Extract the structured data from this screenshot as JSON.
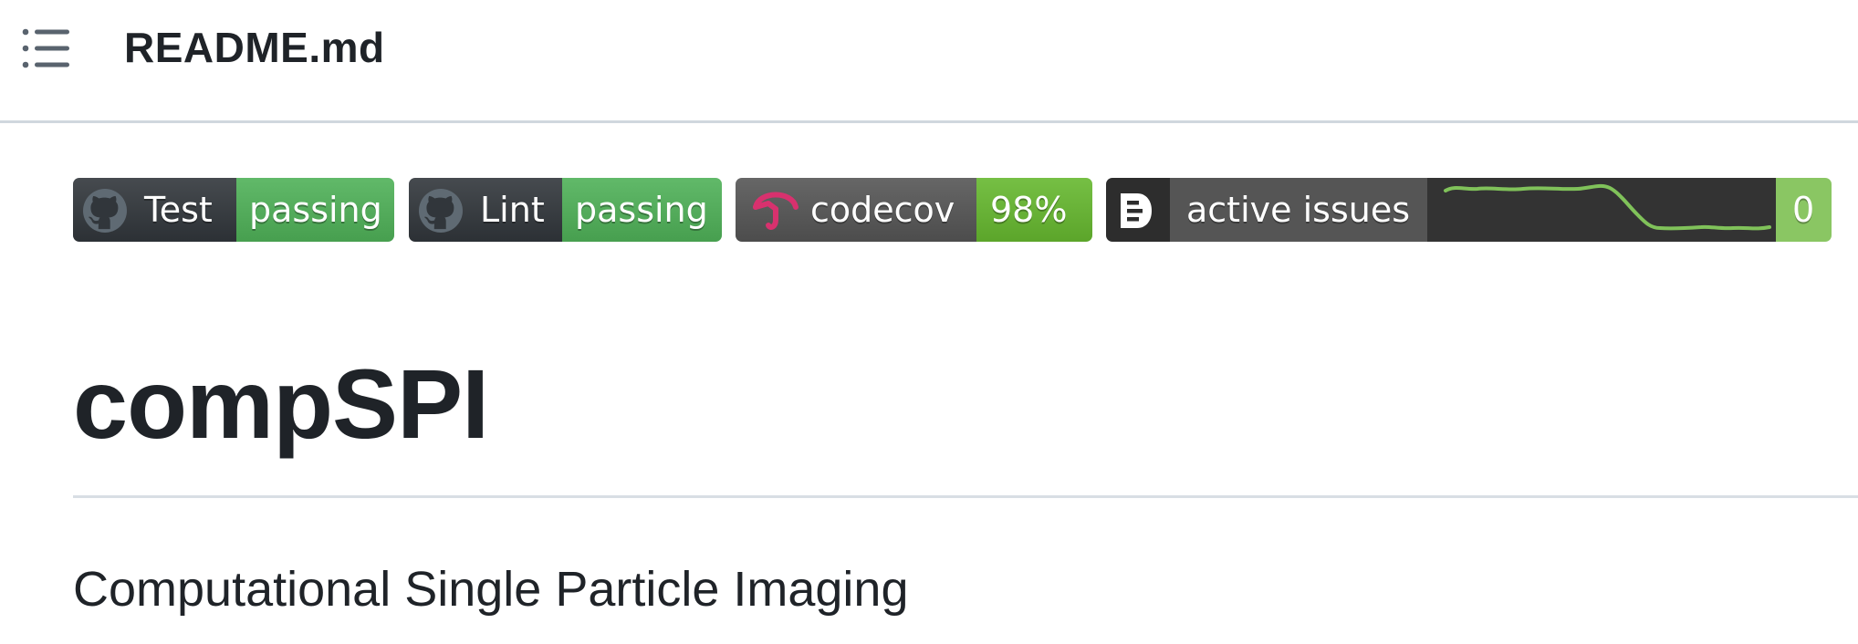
{
  "header": {
    "toc_icon": "list-unordered-icon",
    "file_title": "README.md"
  },
  "badges": [
    {
      "icon": "github-icon",
      "label": "Test",
      "status": "passing",
      "status_color": "#4fb158"
    },
    {
      "icon": "github-icon",
      "label": "Lint",
      "status": "passing",
      "status_color": "#4fb158"
    },
    {
      "icon": "codecov-umbrella-icon",
      "label": "codecov",
      "status": "98%",
      "status_color": "#66b82f"
    },
    {
      "icon": "deepsource-icon",
      "label": "active issues",
      "status": "0",
      "status_color": "#8ac663",
      "sparkline": "issues-trend-sparkline"
    }
  ],
  "readme": {
    "heading": "compSPI",
    "subtitle": "Computational Single Particle Imaging"
  },
  "colors": {
    "badge_label_dark": "#31363b",
    "badge_label_grey": "#555555",
    "codecov_pink": "#d8316e",
    "sparkline_green": "#80c25a",
    "divider": "#d0d7de",
    "text": "#1f2328"
  }
}
